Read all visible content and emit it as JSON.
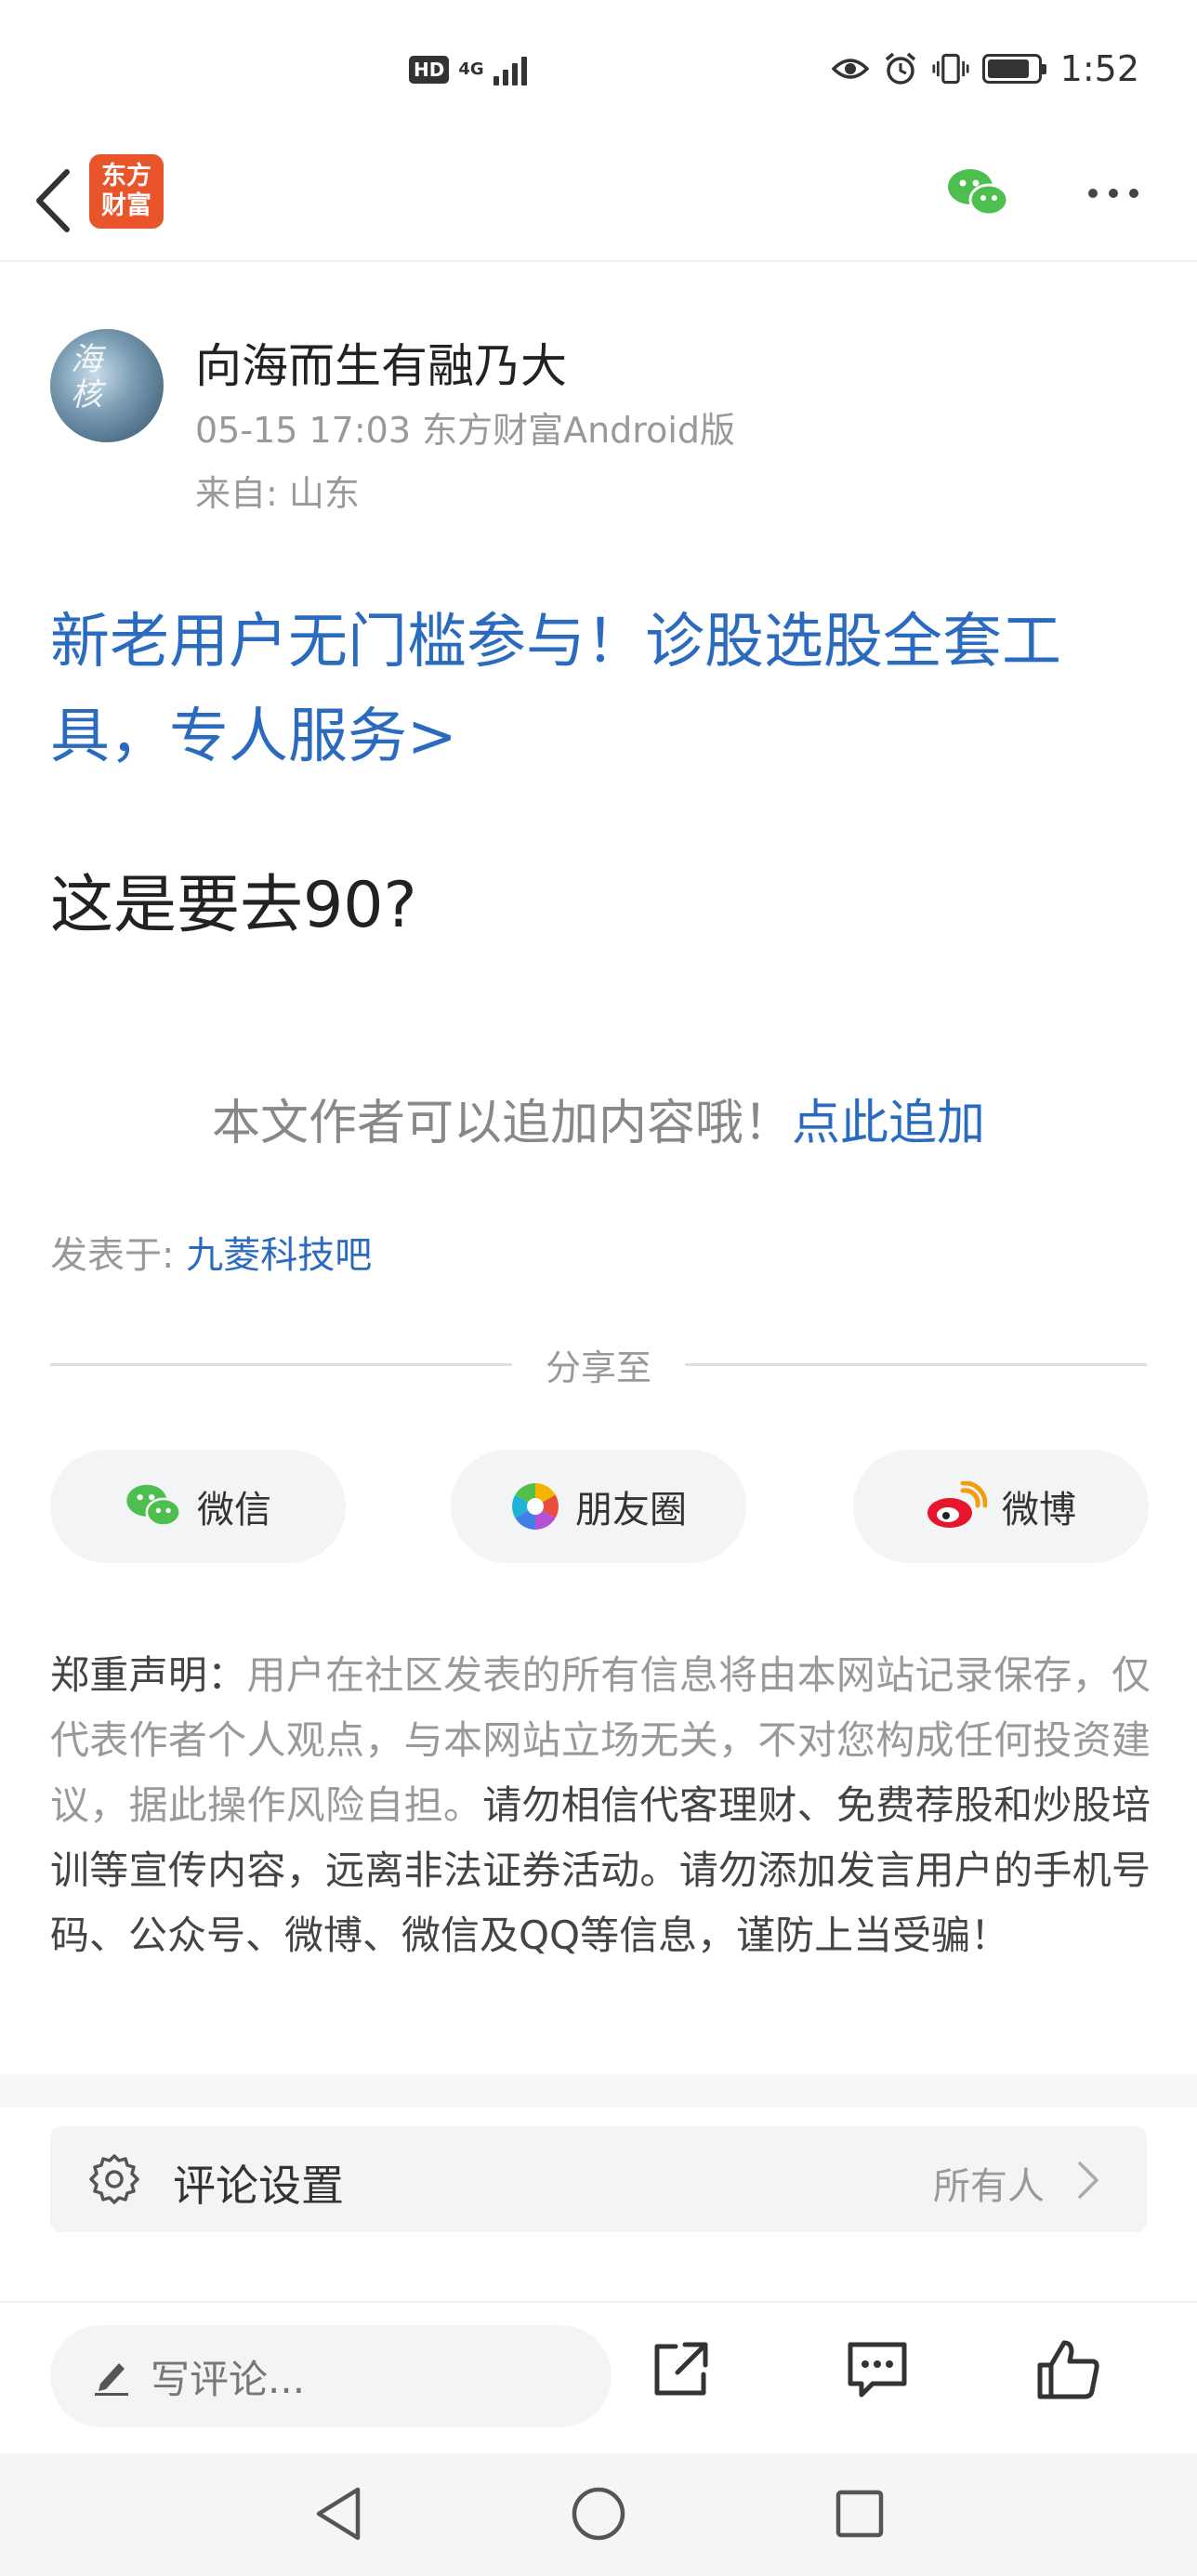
{
  "status_bar": {
    "hd": "HD",
    "network": "4G",
    "time": "1:52",
    "icons": [
      "eye-icon",
      "alarm-icon",
      "vibrate-icon",
      "battery-icon"
    ]
  },
  "nav": {
    "logo_line1": "东方",
    "logo_line2": "财富",
    "icons": [
      "back-icon",
      "wechat-icon",
      "more-icon"
    ]
  },
  "post": {
    "author": "向海而生有融乃大",
    "meta": "05-15 17:03 东方财富Android版",
    "location": "来自: 山东",
    "avatar_text_1": "海",
    "avatar_text_2": "核",
    "promo_text": "新老用户无门槛参与！诊股选股全套工具，专人服务>",
    "body": "这是要去90?",
    "append_hint": "本文作者可以追加内容哦！",
    "append_link": "点此追加",
    "posted_in_label": "发表于: ",
    "forum": "九菱科技吧"
  },
  "share": {
    "title": "分享至",
    "buttons": [
      {
        "label": "微信",
        "icon": "wechat-icon"
      },
      {
        "label": "朋友圈",
        "icon": "moments-icon"
      },
      {
        "label": "微博",
        "icon": "weibo-icon"
      }
    ]
  },
  "disclaimer": {
    "lead": "郑重声明：",
    "normal": "用户在社区发表的所有信息将由本网站记录保存，仅代表作者个人观点，与本网站立场无关，不对您构成任何投资建议，据此操作风险自担。",
    "strong": "请勿相信代客理财、免费荐股和炒股培训等宣传内容，远离非法证券活动。请勿添加发言用户的手机号码、公众号、微博、微信及QQ等信息，谨防上当受骗！"
  },
  "comment_settings": {
    "label": "评论设置",
    "value": "所有人"
  },
  "bottom_bar": {
    "placeholder": "写评论...",
    "icons": [
      "edit-icon",
      "share-icon",
      "comment-icon",
      "like-icon"
    ]
  },
  "colors": {
    "link": "#2a6bbf",
    "brand": "#e9542a",
    "wechat": "#4cbf4e",
    "weibo": "#e6162d"
  }
}
